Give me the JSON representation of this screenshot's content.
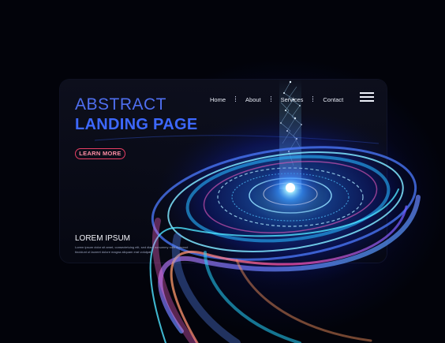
{
  "nav": {
    "items": [
      {
        "label": "Home"
      },
      {
        "label": "About"
      },
      {
        "label": "Services"
      },
      {
        "label": "Contact"
      }
    ]
  },
  "hero": {
    "title_line1": "ABSTRACT",
    "title_line2": "LANDING PAGE",
    "cta_label": "LEARN MORE"
  },
  "footer": {
    "heading": "LOREM IPSUM",
    "body": "Lorem ipsum dolor sit amet, consectetuing elit, sed diam nonummy nibh euismod tincidunt ut laoreet dolore magna aliquam erat volutpat."
  },
  "icons": {
    "menu": "hamburger-icon"
  },
  "colors": {
    "background": "#02030a",
    "accent_blue": "#3d68ff",
    "cta_border": "#e63e63",
    "glow_cyan": "#6fd8ff"
  }
}
